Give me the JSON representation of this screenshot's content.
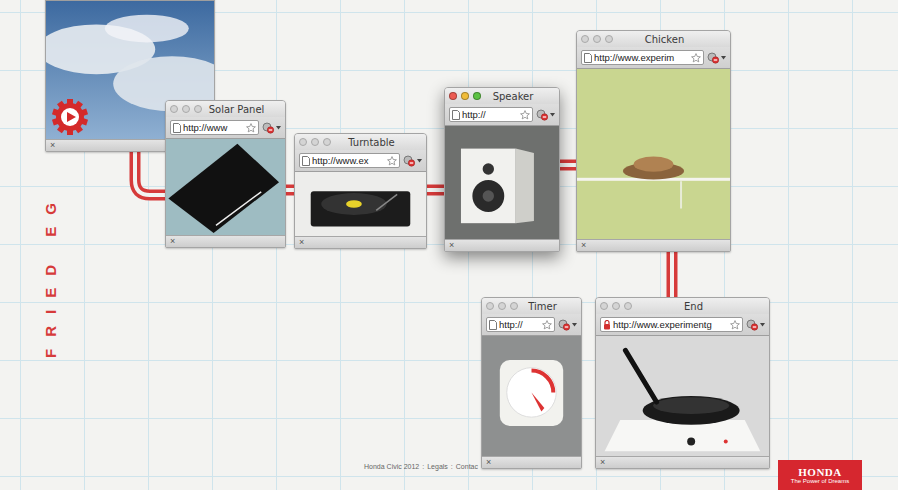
{
  "page": {
    "side_title": "FRIED EG"
  },
  "windows": [
    {
      "title": "",
      "url": "",
      "secure": true,
      "active": false,
      "kind": "sky",
      "close": "×"
    },
    {
      "title": "Solar Panel",
      "url": "http://www",
      "secure": false,
      "active": false,
      "kind": "solar-panel",
      "close": "×"
    },
    {
      "title": "Turntable",
      "url": "http://www.ex",
      "secure": false,
      "active": false,
      "kind": "turntable",
      "close": "×"
    },
    {
      "title": "Speaker",
      "url": "http://",
      "secure": false,
      "active": true,
      "kind": "speaker",
      "close": "×"
    },
    {
      "title": "Chicken",
      "url": "http://www.experim",
      "secure": false,
      "active": false,
      "kind": "chicken",
      "close": "×"
    },
    {
      "title": "Timer",
      "url": "http://",
      "secure": false,
      "active": false,
      "kind": "timer",
      "close": "×"
    },
    {
      "title": "End",
      "url": "http://www.experimentg",
      "secure": true,
      "active": false,
      "kind": "pan",
      "close": "×"
    }
  ],
  "footer": {
    "links": [
      "Honda Civic 2012",
      "Legals",
      "Contac"
    ],
    "separator": ":"
  },
  "brand": {
    "name": "HONDA",
    "tagline": "The Power of Dreams"
  }
}
